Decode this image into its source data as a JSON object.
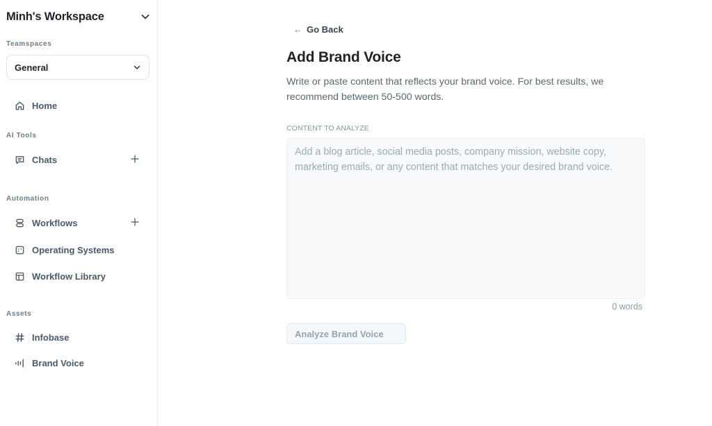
{
  "sidebar": {
    "workspace_title": "Minh's Workspace",
    "teamspaces_label": "Teamspaces",
    "teamspace_selected": "General",
    "home_label": "Home",
    "ai_tools_label": "AI Tools",
    "chats_label": "Chats",
    "automation_label": "Automation",
    "workflows_label": "Workflows",
    "operating_systems_label": "Operating Systems",
    "workflow_library_label": "Workflow Library",
    "assets_label": "Assets",
    "infobase_label": "Infobase",
    "brand_voice_label": "Brand Voice"
  },
  "main": {
    "go_back_arrow": "←",
    "go_back_label": "Go Back",
    "title": "Add Brand Voice",
    "description": "Write or paste content that reflects your brand voice. For best results, we recommend between 50-500 words.",
    "field_label": "CONTENT TO ANALYZE",
    "content_value": "",
    "content_placeholder": "Add a blog article, social media posts, company mission, website copy, marketing emails, or any content that matches your desired brand voice.",
    "word_count": "0 words",
    "analyze_button_label": "Analyze Brand Voice",
    "analyze_button_arrow": "→"
  }
}
